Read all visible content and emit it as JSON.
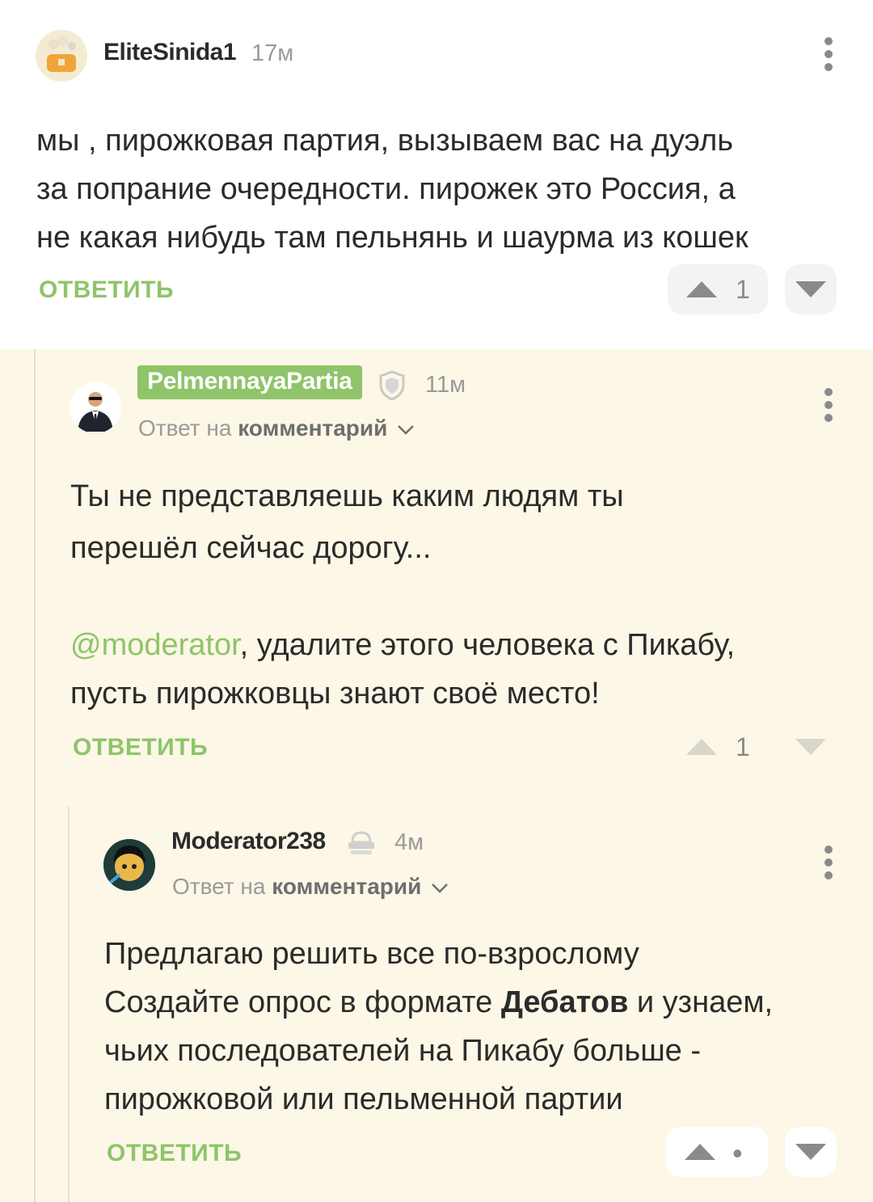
{
  "comments": [
    {
      "username": "EliteSinida1",
      "time": "17м",
      "lines": [
        "мы , пирожковая партия, вызываем вас на дуэль",
        "за попрание очередности. пирожек это Россия, а",
        "не какая нибудь там пельнянь и шаурма из кошек"
      ],
      "reply_label": "ОТВЕТИТЬ",
      "score": "1"
    },
    {
      "username": "PelmennayaPartia",
      "time": "11м",
      "reply_to_prefix": "Ответ на",
      "reply_to_target": "комментарий",
      "lines": [
        "Ты не представляешь каким людям ты",
        "перешёл сейчас дорогу..."
      ],
      "mention": "@moderator",
      "mention_rest": ", удалите этого человека с Пикабу,",
      "line_last": "пусть пирожковцы знают своё место!",
      "reply_label": "ОТВЕТИТЬ",
      "score": "1"
    },
    {
      "username": "Moderator238",
      "time": "4м",
      "reply_to_prefix": "Ответ на",
      "reply_to_target": "комментарий",
      "line1": "Предлагаю решить все по-взрослому",
      "line2_pre": "Создайте опрос в формате ",
      "line2_bold": "Дебатов",
      "line2_post": " и узнаем,",
      "line3": "чьих последователей на Пикабу больше -",
      "line4": "пирожковой или пельменной партии",
      "reply_label": "ОТВЕТИТЬ",
      "score": "•"
    }
  ],
  "icons": {
    "more": "more-vertical-icon",
    "upvote": "arrow-up-icon",
    "downvote": "arrow-down-icon",
    "shield": "shield-icon",
    "moderator": "moderator-icon",
    "chevron": "chevron-down-icon"
  },
  "colors": {
    "accent": "#8fc46a",
    "thread_bg": "#fcf7e6"
  }
}
